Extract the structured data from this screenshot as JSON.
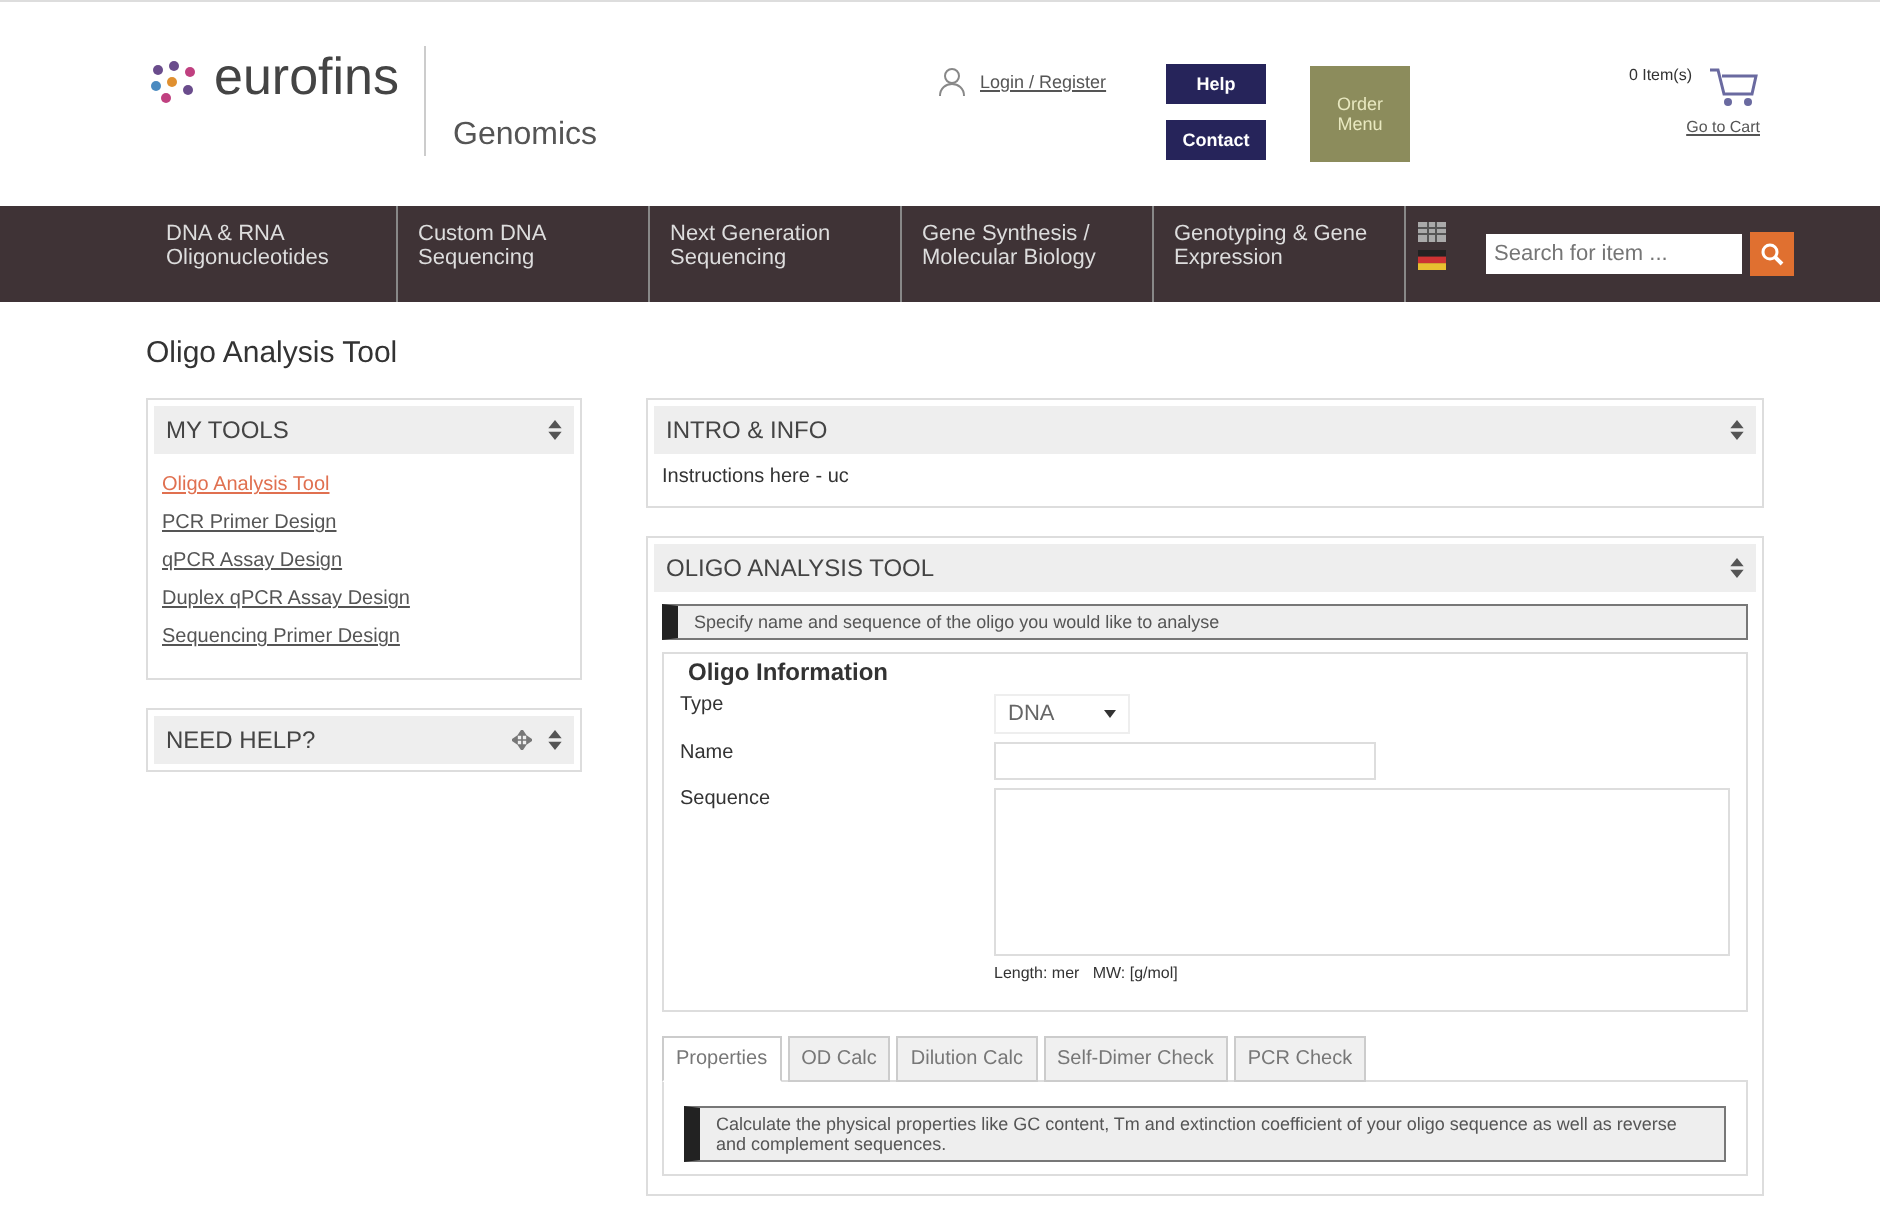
{
  "header": {
    "logo": "eurofins",
    "division": "Genomics",
    "login": "Login / Register",
    "help": "Help",
    "contact": "Contact",
    "order_menu": "Order Menu",
    "cart_count": "0 Item(s)",
    "cart_link": "Go to Cart"
  },
  "nav": {
    "items": [
      "DNA & RNA Oligonucleotides",
      "Custom DNA Sequencing",
      "Next Generation Sequencing",
      "Gene Synthesis / Molecular Biology",
      "Genotyping & Gene Expression"
    ],
    "search": {
      "placeholder": "Search for item ..."
    }
  },
  "page_title": "Oligo Analysis Tool",
  "sidebar": {
    "my_tools": {
      "title": "MY TOOLS",
      "items": [
        {
          "label": "Oligo Analysis Tool",
          "selected": true
        },
        {
          "label": "PCR Primer Design",
          "selected": false
        },
        {
          "label": "qPCR Assay Design",
          "selected": false
        },
        {
          "label": "Duplex qPCR Assay Design",
          "selected": false
        },
        {
          "label": "Sequencing Primer Design",
          "selected": false
        }
      ]
    },
    "need_help": {
      "title": "NEED HELP?"
    }
  },
  "intro": {
    "title": "INTRO & INFO",
    "text": "Instructions here - uc"
  },
  "tool": {
    "title": "OLIGO ANALYSIS TOOL",
    "hint": "Specify name and sequence of the oligo you would like to analyse",
    "legend": "Oligo Information",
    "type_label": "Type",
    "type_value": "DNA",
    "name_label": "Name",
    "sequence_label": "Sequence",
    "stats": "Length: mer   MW: [g/mol]",
    "tabs": [
      {
        "label": "Properties",
        "selected": true
      },
      {
        "label": "OD Calc",
        "selected": false
      },
      {
        "label": "Dilution Calc",
        "selected": false
      },
      {
        "label": "Self-Dimer Check",
        "selected": false
      },
      {
        "label": "PCR Check",
        "selected": false
      }
    ],
    "tab_hint": "Calculate the physical properties like GC content, Tm and extinction coefficient of your oligo sequence as well as reverse and complement sequences."
  }
}
